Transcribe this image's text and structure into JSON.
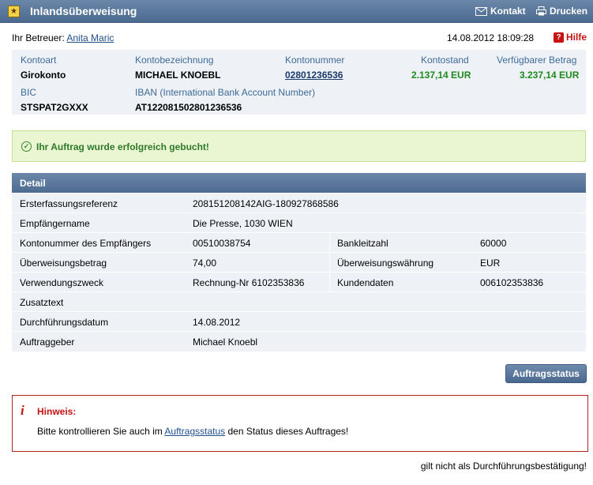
{
  "titlebar": {
    "icon": "folder-star-icon",
    "title": "Inlandsüberweisung",
    "kontakt": "Kontakt",
    "drucken": "Drucken"
  },
  "header": {
    "betreuer_label": "Ihr Betreuer:",
    "betreuer_name": "Anita Maric",
    "datetime": "14.08.2012 18:09:28",
    "hilfe": "Hilfe"
  },
  "account": {
    "kontoart_label": "Kontoart",
    "kontoart": "Girokonto",
    "bezeichnung_label": "Kontobezeichnung",
    "bezeichnung": "MICHAEL KNOEBL",
    "nummer_label": "Kontonummer",
    "nummer": "02801236536",
    "stand_label": "Kontostand",
    "stand": "2.137,14 EUR",
    "verfuegbar_label": "Verfügbarer Betrag",
    "verfuegbar": "3.237,14 EUR",
    "bic_label": "BIC",
    "bic": "STSPAT2GXXX",
    "iban_label": "IBAN (International Bank Account Number)",
    "iban": "AT122081502801236536"
  },
  "success": {
    "text": "Ihr Auftrag wurde erfolgreich gebucht!"
  },
  "detail": {
    "title": "Detail",
    "rows": {
      "r0": {
        "label": "Ersterfassungsreferenz",
        "value": "208151208142AIG-180927868586"
      },
      "r1": {
        "label": "Empfängername",
        "value": "Die Presse, 1030 WIEN"
      },
      "r2": {
        "label": "Kontonummer des Empfängers",
        "value": "00510038754",
        "label2": "Bankleitzahl",
        "value2": "60000"
      },
      "r3": {
        "label": "Überweisungsbetrag",
        "value": "74,00",
        "label2": "Überweisungswährung",
        "value2": "EUR"
      },
      "r4": {
        "label": "Verwendungszweck",
        "value": "Rechnung-Nr 6102353836",
        "label2": "Kundendaten",
        "value2": "006102353836"
      },
      "r5": {
        "label": "Zusatztext",
        "value": ""
      },
      "r6": {
        "label": "Durchführungsdatum",
        "value": "14.08.2012"
      },
      "r7": {
        "label": "Auftraggeber",
        "value": "Michael Knoebl"
      }
    }
  },
  "buttons": {
    "auftragsstatus": "Auftragsstatus"
  },
  "hinweis": {
    "title": "Hinweis:",
    "text_before": "Bitte kontrollieren Sie auch im",
    "link": "Auftragsstatus",
    "text_after": "den Status dieses Auftrages!"
  },
  "footer": {
    "note": "gilt nicht als Durchführungsbestätigung!"
  },
  "colors": {
    "header_blue": "#4a6a90",
    "success_green": "#2f7a2a",
    "alert_red": "#c81212",
    "panel_bg": "#eef2f7"
  }
}
